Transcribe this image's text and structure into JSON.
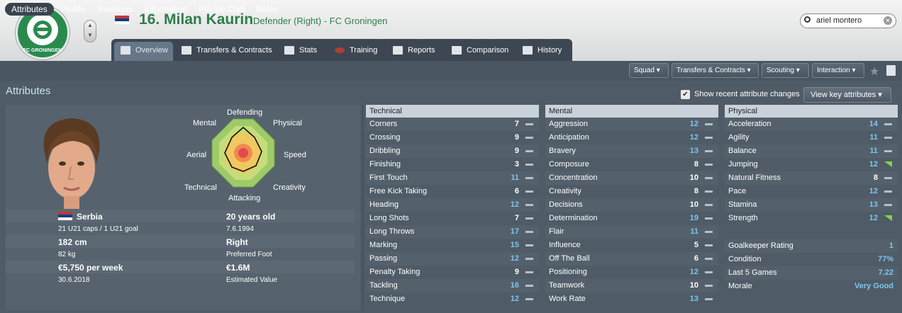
{
  "header": {
    "club_logo_text": "FC GRONINGEN",
    "squad_number": "16.",
    "player_name": "Milan Kaurin",
    "description": "Defender (Right) - FC Groningen",
    "search_value": "ariel montero",
    "colors": {
      "accent_green": "#2d7d4a",
      "highlight_blue": "#7cc6ee"
    }
  },
  "tabs": [
    {
      "label": "Overview",
      "icon": "overview-icon"
    },
    {
      "label": "Transfers & Contracts",
      "icon": "contract-icon"
    },
    {
      "label": "Stats",
      "icon": "stats-icon"
    },
    {
      "label": "Training",
      "icon": "training-icon"
    },
    {
      "label": "Reports",
      "icon": "reports-icon"
    },
    {
      "label": "Comparison",
      "icon": "comparison-icon"
    },
    {
      "label": "History",
      "icon": "history-icon"
    }
  ],
  "subtabs": [
    "Attributes",
    "Profile",
    "Positions",
    "Information",
    "Private Chat",
    "Notes"
  ],
  "dropdowns": [
    "Squad",
    "Transfers & Contracts",
    "Scouting",
    "Interaction"
  ],
  "page": {
    "title": "Attributes",
    "show_recent_label": "Show recent attribute changes",
    "show_recent_checked": true,
    "view_key_label": "View key attributes"
  },
  "radar": {
    "labels": {
      "top": "Defending",
      "top_right": "Physical",
      "right": "Speed",
      "bottom_right": "Creativity",
      "bottom": "Attacking",
      "bottom_left": "Technical",
      "left": "Aerial",
      "top_left": "Mental"
    }
  },
  "profile": {
    "nationality": "Serbia",
    "caps": "21 U21 caps / 1 U21 goal",
    "age": "20 years old",
    "dob": "7.6.1994",
    "height": "182 cm",
    "weight": "82 kg",
    "foot": "Right",
    "foot_label": "Preferred Foot",
    "wage": "€5,750 per week",
    "contract_end": "30.6.2018",
    "value": "€1.6M",
    "value_label": "Estimated Value"
  },
  "technical": {
    "header": "Technical",
    "rows": [
      {
        "name": "Corners",
        "value": "7",
        "hi": false,
        "trend": "flat"
      },
      {
        "name": "Crossing",
        "value": "9",
        "hi": false,
        "trend": "flat"
      },
      {
        "name": "Dribbling",
        "value": "9",
        "hi": false,
        "trend": "flat"
      },
      {
        "name": "Finishing",
        "value": "3",
        "hi": false,
        "trend": "flat"
      },
      {
        "name": "First Touch",
        "value": "11",
        "hi": true,
        "trend": "flat"
      },
      {
        "name": "Free Kick Taking",
        "value": "6",
        "hi": false,
        "trend": "flat"
      },
      {
        "name": "Heading",
        "value": "12",
        "hi": true,
        "trend": "flat"
      },
      {
        "name": "Long Shots",
        "value": "7",
        "hi": false,
        "trend": "flat"
      },
      {
        "name": "Long Throws",
        "value": "17",
        "hi": true,
        "trend": "flat"
      },
      {
        "name": "Marking",
        "value": "15",
        "hi": true,
        "trend": "flat"
      },
      {
        "name": "Passing",
        "value": "12",
        "hi": true,
        "trend": "flat"
      },
      {
        "name": "Penalty Taking",
        "value": "9",
        "hi": false,
        "trend": "flat"
      },
      {
        "name": "Tackling",
        "value": "16",
        "hi": true,
        "trend": "flat"
      },
      {
        "name": "Technique",
        "value": "12",
        "hi": true,
        "trend": "flat"
      }
    ]
  },
  "mental": {
    "header": "Mental",
    "rows": [
      {
        "name": "Aggression",
        "value": "12",
        "hi": true,
        "trend": "flat"
      },
      {
        "name": "Anticipation",
        "value": "12",
        "hi": true,
        "trend": "flat"
      },
      {
        "name": "Bravery",
        "value": "13",
        "hi": true,
        "trend": "flat"
      },
      {
        "name": "Composure",
        "value": "8",
        "hi": false,
        "trend": "flat"
      },
      {
        "name": "Concentration",
        "value": "10",
        "hi": false,
        "trend": "flat"
      },
      {
        "name": "Creativity",
        "value": "8",
        "hi": false,
        "trend": "flat"
      },
      {
        "name": "Decisions",
        "value": "10",
        "hi": false,
        "trend": "flat"
      },
      {
        "name": "Determination",
        "value": "19",
        "hi": true,
        "trend": "flat"
      },
      {
        "name": "Flair",
        "value": "11",
        "hi": true,
        "trend": "flat"
      },
      {
        "name": "Influence",
        "value": "5",
        "hi": false,
        "trend": "flat"
      },
      {
        "name": "Off The Ball",
        "value": "6",
        "hi": false,
        "trend": "flat"
      },
      {
        "name": "Positioning",
        "value": "12",
        "hi": true,
        "trend": "flat"
      },
      {
        "name": "Teamwork",
        "value": "10",
        "hi": false,
        "trend": "flat"
      },
      {
        "name": "Work Rate",
        "value": "13",
        "hi": true,
        "trend": "flat"
      }
    ]
  },
  "physical": {
    "header": "Physical",
    "rows": [
      {
        "name": "Acceleration",
        "value": "14",
        "hi": true,
        "trend": "flat"
      },
      {
        "name": "Agility",
        "value": "11",
        "hi": true,
        "trend": "flat"
      },
      {
        "name": "Balance",
        "value": "11",
        "hi": true,
        "trend": "flat"
      },
      {
        "name": "Jumping",
        "value": "12",
        "hi": true,
        "trend": "up"
      },
      {
        "name": "Natural Fitness",
        "value": "8",
        "hi": false,
        "trend": "flat"
      },
      {
        "name": "Pace",
        "value": "12",
        "hi": true,
        "trend": "flat"
      },
      {
        "name": "Stamina",
        "value": "13",
        "hi": true,
        "trend": "flat"
      },
      {
        "name": "Strength",
        "value": "12",
        "hi": true,
        "trend": "up"
      }
    ],
    "extra": [
      {
        "name": "Goalkeeper Rating",
        "value": "1"
      },
      {
        "name": "Condition",
        "value": "77%"
      },
      {
        "name": "Last 5 Games",
        "value": "7.22"
      },
      {
        "name": "Morale",
        "value": "Very Good"
      }
    ]
  }
}
